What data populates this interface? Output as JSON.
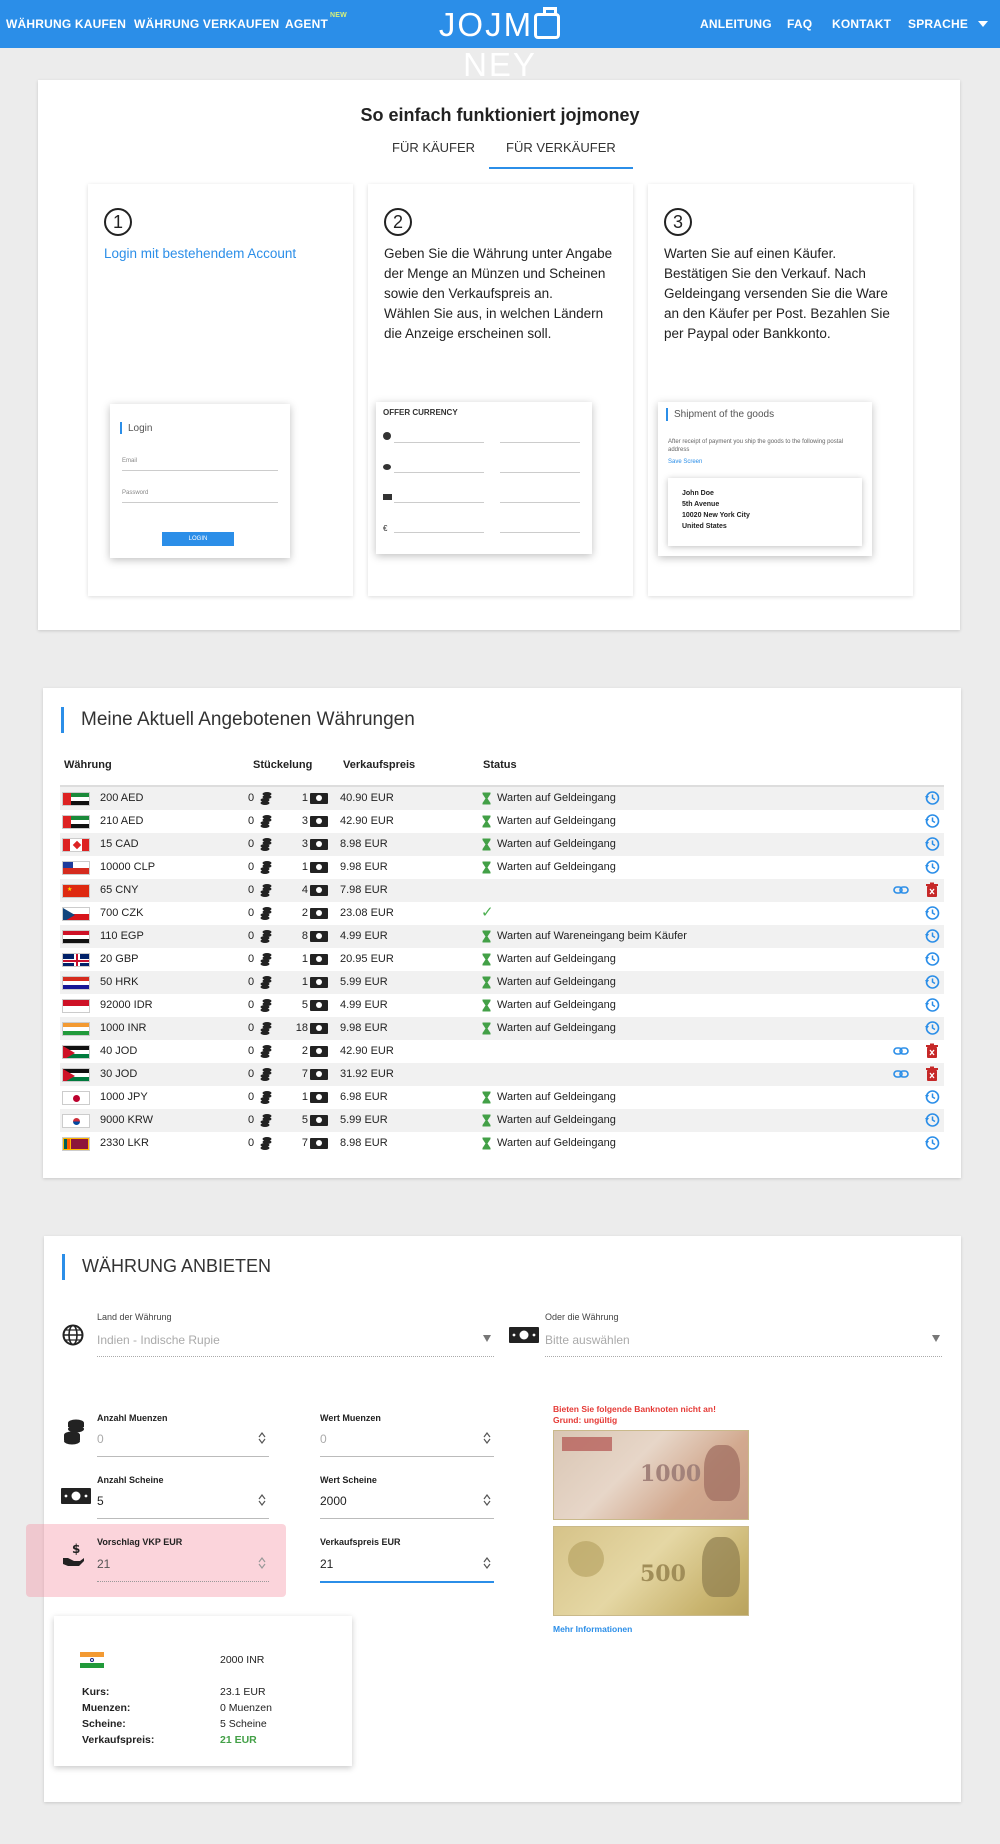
{
  "nav": {
    "buy": "WÄHRUNG KAUFEN",
    "sell": "WÄHRUNG VERKAUFEN",
    "agent": "AGENT",
    "agent_badge": "NEW",
    "logo": "JOJMONEY",
    "guide": "ANLEITUNG",
    "faq": "FAQ",
    "contact": "KONTAKT",
    "language": "SPRACHE",
    "color": "#2b8ee8"
  },
  "how": {
    "title": "So einfach funktioniert jojmoney",
    "tab_buyer": "FÜR KÄUFER",
    "tab_seller": "FÜR VERKÄUFER",
    "active_tab": "FÜR VERKÄUFER",
    "steps": [
      {
        "number": "1",
        "text": "Login mit bestehendem Account",
        "mock": {
          "title": "Login",
          "email_label": "Email",
          "password_label": "Password",
          "button": "LOGIN"
        }
      },
      {
        "number": "2",
        "text": "Geben Sie die Währung unter Angabe der Menge an Münzen und Scheinen sowie den Verkaufspreis an.\nWählen Sie aus, in welchen Ländern die Anzeige erscheinen soll.",
        "mock": {
          "title": "OFFER CURRENCY"
        }
      },
      {
        "number": "3",
        "text": "Warten Sie auf einen Käufer. Bestätigen Sie den Verkauf. Nach Geldeingang versenden Sie die Ware an den Käufer per Post. Bezahlen Sie per Paypal oder Bankkonto.",
        "mock": {
          "title": "Shipment of the goods",
          "text": "After receipt of payment you ship the goods to the following postal address",
          "link": "Save Screen",
          "address": [
            "John Doe",
            "5th Avenue",
            "10020 New York City",
            "United States"
          ]
        }
      }
    ]
  },
  "offers": {
    "title": "Meine Aktuell Angebotenen Währungen",
    "headers": {
      "currency": "Währung",
      "denomination": "Stückelung",
      "price": "Verkaufspreis",
      "status": "Status"
    },
    "rows": [
      {
        "flag": "ae",
        "amount": "200 AED",
        "coins": "0",
        "notes": "1",
        "price": "40.90 EUR",
        "status": "Warten auf Geldeingang",
        "state": "waiting"
      },
      {
        "flag": "ae",
        "amount": "210 AED",
        "coins": "0",
        "notes": "3",
        "price": "42.90 EUR",
        "status": "Warten auf Geldeingang",
        "state": "waiting"
      },
      {
        "flag": "ca",
        "amount": "15 CAD",
        "coins": "0",
        "notes": "3",
        "price": "8.98 EUR",
        "status": "Warten auf Geldeingang",
        "state": "waiting"
      },
      {
        "flag": "cl",
        "amount": "10000 CLP",
        "coins": "0",
        "notes": "1",
        "price": "9.98 EUR",
        "status": "Warten auf Geldeingang",
        "state": "waiting"
      },
      {
        "flag": "cn",
        "amount": "65 CNY",
        "coins": "0",
        "notes": "4",
        "price": "7.98 EUR",
        "status": "",
        "state": "open"
      },
      {
        "flag": "cz",
        "amount": "700 CZK",
        "coins": "0",
        "notes": "2",
        "price": "23.08 EUR",
        "status": "",
        "state": "done"
      },
      {
        "flag": "eg",
        "amount": "110 EGP",
        "coins": "0",
        "notes": "8",
        "price": "4.99 EUR",
        "status": "Warten auf Wareneingang beim Käufer",
        "state": "waiting"
      },
      {
        "flag": "gb",
        "amount": "20 GBP",
        "coins": "0",
        "notes": "1",
        "price": "20.95 EUR",
        "status": "Warten auf Geldeingang",
        "state": "waiting"
      },
      {
        "flag": "hr",
        "amount": "50 HRK",
        "coins": "0",
        "notes": "1",
        "price": "5.99 EUR",
        "status": "Warten auf Geldeingang",
        "state": "waiting"
      },
      {
        "flag": "id",
        "amount": "92000 IDR",
        "coins": "0",
        "notes": "5",
        "price": "4.99 EUR",
        "status": "Warten auf Geldeingang",
        "state": "waiting"
      },
      {
        "flag": "in",
        "amount": "1000 INR",
        "coins": "0",
        "notes": "18",
        "price": "9.98 EUR",
        "status": "Warten auf Geldeingang",
        "state": "waiting"
      },
      {
        "flag": "jo",
        "amount": "40 JOD",
        "coins": "0",
        "notes": "2",
        "price": "42.90 EUR",
        "status": "",
        "state": "open"
      },
      {
        "flag": "jo",
        "amount": "30 JOD",
        "coins": "0",
        "notes": "7",
        "price": "31.92 EUR",
        "status": "",
        "state": "open"
      },
      {
        "flag": "jp",
        "amount": "1000 JPY",
        "coins": "0",
        "notes": "1",
        "price": "6.98 EUR",
        "status": "Warten auf Geldeingang",
        "state": "waiting"
      },
      {
        "flag": "kr",
        "amount": "9000 KRW",
        "coins": "0",
        "notes": "5",
        "price": "5.99 EUR",
        "status": "Warten auf Geldeingang",
        "state": "waiting"
      },
      {
        "flag": "lk",
        "amount": "2330 LKR",
        "coins": "0",
        "notes": "7",
        "price": "8.98 EUR",
        "status": "Warten auf Geldeingang",
        "state": "waiting"
      }
    ]
  },
  "offer_form": {
    "title": "WÄHRUNG ANBIETEN",
    "country_label": "Land der Währung",
    "country_value": "Indien - Indische Rupie",
    "or_currency_label": "Oder die Währung",
    "or_currency_placeholder": "Bitte auswählen",
    "coins_count_label": "Anzahl Muenzen",
    "coins_count_value": "0",
    "coins_value_label": "Wert Muenzen",
    "coins_value_value": "0",
    "notes_count_label": "Anzahl Scheine",
    "notes_count_value": "5",
    "notes_value_label": "Wert Scheine",
    "notes_value_value": "2000",
    "suggested_label": "Vorschlag VKP EUR",
    "suggested_value": "21",
    "price_label": "Verkaufspreis EUR",
    "price_value": "21",
    "warning_line1": "Bieten Sie folgende Banknoten nicht an!",
    "warning_line2": "Grund: ungültig",
    "more_info": "Mehr Informationen",
    "summary": {
      "flag": "in",
      "amount": "2000 INR",
      "rate_label": "Kurs:",
      "rate_value": "23.1 EUR",
      "coins_label": "Muenzen:",
      "coins_value": "0 Muenzen",
      "notes_label": "Scheine:",
      "notes_value": "5 Scheine",
      "price_label": "Verkaufspreis:",
      "price_value": "21 EUR"
    }
  }
}
